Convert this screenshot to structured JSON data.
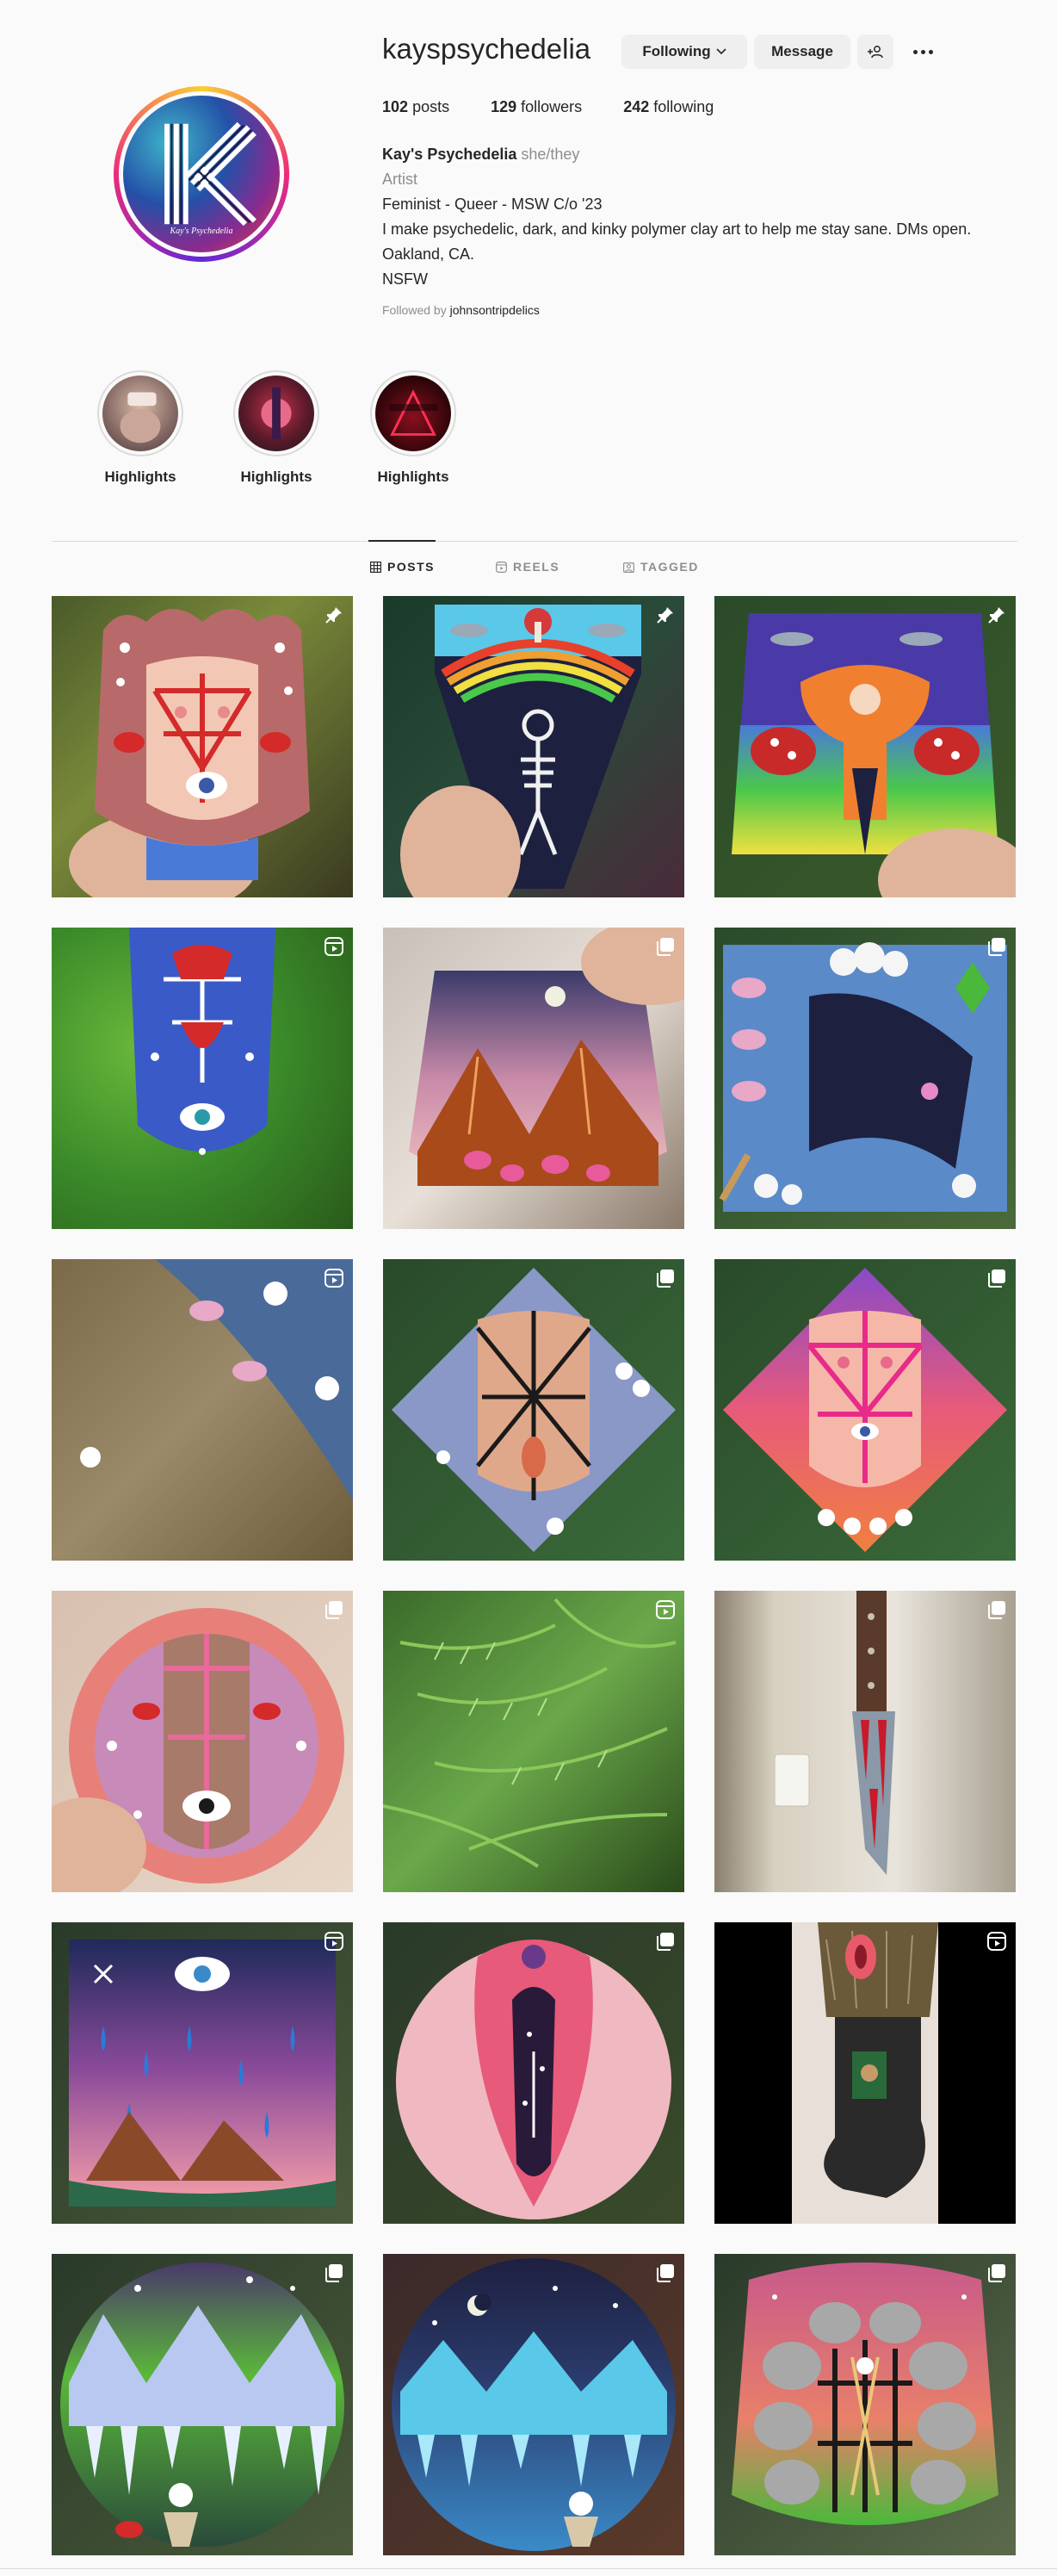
{
  "profile": {
    "username": "kayspsychedelia",
    "avatar_icon": "k-monogram-avatar",
    "avatar_caption": "Kay's Psychedelia",
    "following_label": "Following",
    "message_label": "Message",
    "suggest_icon": "add-person-icon",
    "more_icon": "more-options-icon"
  },
  "stats": {
    "posts_count": "102",
    "posts_label": "posts",
    "followers_count": "129",
    "followers_label": "followers",
    "following_count": "242",
    "following_label": "following"
  },
  "bio": {
    "name": "Kay's Psychedelia",
    "pronouns": "she/they",
    "category": "Artist",
    "line1": "Feminist - Queer - MSW C/o '23",
    "line2": "I make psychedelic, dark, and kinky polymer clay art to help me stay sane. DMs open.",
    "line3": "Oakland, CA.",
    "line4": "NSFW",
    "followed_by_prefix": "Followed by",
    "followed_by_user": "johnsontripdelics"
  },
  "highlights": [
    {
      "label": "Highlights"
    },
    {
      "label": "Highlights"
    },
    {
      "label": "Highlights"
    }
  ],
  "tabs": [
    {
      "label": "POSTS",
      "icon": "grid-icon",
      "active": true
    },
    {
      "label": "REELS",
      "icon": "reels-icon",
      "active": false
    },
    {
      "label": "TAGGED",
      "icon": "tagged-icon",
      "active": false
    }
  ],
  "posts": [
    {
      "badge": "pin-icon"
    },
    {
      "badge": "pin-icon"
    },
    {
      "badge": "pin-icon"
    },
    {
      "badge": "reel-icon"
    },
    {
      "badge": "carousel-icon"
    },
    {
      "badge": "carousel-icon"
    },
    {
      "badge": "reel-icon"
    },
    {
      "badge": "carousel-icon"
    },
    {
      "badge": "carousel-icon"
    },
    {
      "badge": "carousel-icon"
    },
    {
      "badge": "reel-icon"
    },
    {
      "badge": "carousel-icon"
    },
    {
      "badge": "reel-icon"
    },
    {
      "badge": "carousel-icon"
    },
    {
      "badge": "reel-icon"
    },
    {
      "badge": "carousel-icon"
    },
    {
      "badge": "carousel-icon"
    },
    {
      "badge": "carousel-icon"
    }
  ],
  "colors": {
    "text": "#262626",
    "secondary": "#8e8e8e",
    "button_bg": "#efefef",
    "border": "#dbdbdb",
    "background": "#fafafa"
  }
}
